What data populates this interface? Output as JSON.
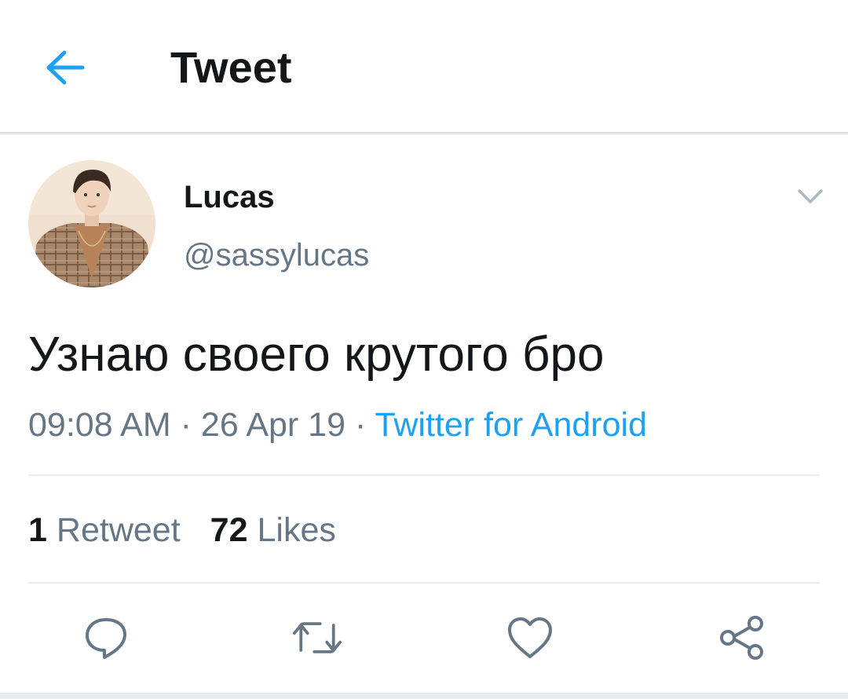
{
  "header": {
    "back_icon": "arrow-left-icon",
    "title": "Tweet",
    "accent": "#1da1f2"
  },
  "tweet": {
    "author": {
      "display_name": "Lucas",
      "handle": "@sassylucas",
      "avatar": "avatar-photo"
    },
    "menu_icon": "chevron-down-icon",
    "text": "Узнаю своего крутого бро",
    "time": "09:08 AM",
    "date": "26 Apr 19",
    "separator": "·",
    "source": "Twitter for Android",
    "stats": {
      "retweets_count": "1",
      "retweets_label": "Retweet",
      "likes_count": "72",
      "likes_label": "Likes"
    },
    "actions": [
      {
        "name": "reply",
        "icon": "speech-bubble-icon"
      },
      {
        "name": "retweet",
        "icon": "retweet-icon"
      },
      {
        "name": "like",
        "icon": "heart-icon"
      },
      {
        "name": "share",
        "icon": "share-icon"
      }
    ]
  },
  "colors": {
    "text": "#14171a",
    "secondary": "#657786",
    "link": "#1da1f2",
    "divider": "#e6ecf0"
  }
}
